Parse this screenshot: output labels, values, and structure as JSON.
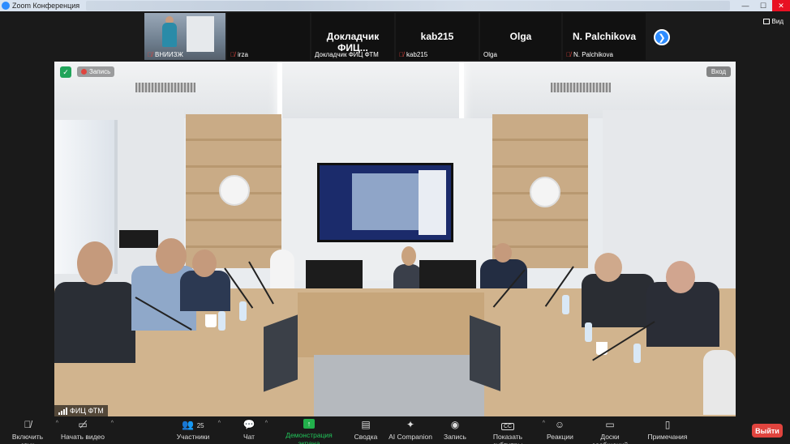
{
  "window": {
    "title": "Zoom Конференция"
  },
  "gallery": {
    "tiles": [
      {
        "label": "ВНИИЗЖ",
        "muted": true,
        "has_video": true
      },
      {
        "label": "irza",
        "muted": true,
        "has_video": false,
        "big_name": ""
      },
      {
        "label": "Докладчик ФИЦ ФТМ",
        "muted": false,
        "has_video": false,
        "big_name": "Докладчик  ФИЦ..."
      },
      {
        "label": "kab215",
        "muted": true,
        "has_video": false,
        "big_name": "kab215"
      },
      {
        "label": "Olga",
        "muted": false,
        "has_video": false,
        "big_name": "Olga"
      },
      {
        "label": "N. Palchikova",
        "muted": true,
        "has_video": false,
        "big_name": "N. Palchikova"
      }
    ],
    "view_label": "Вид"
  },
  "video": {
    "recording_label": "Запись",
    "enter_label": "Вход",
    "speaker_name": "ФИЦ ФТМ"
  },
  "toolbar": {
    "unmute": "Включить звук",
    "start_video": "Начать видео",
    "participants": "Участники",
    "participants_count": "25",
    "chat": "Чат",
    "share_screen": "Демонстрация экрана",
    "summary": "Сводка",
    "ai_companion": "AI Companion",
    "record": "Запись",
    "captions": "Показать субтитры",
    "captions_icon": "CC",
    "reactions": "Реакции",
    "whiteboards": "Доски сообщений",
    "notes": "Примечания",
    "leave": "Выйти"
  },
  "colors": {
    "accent": "#2d8cff",
    "leave": "#e0443e",
    "share": "#22b04b",
    "secure": "#21a45a"
  }
}
